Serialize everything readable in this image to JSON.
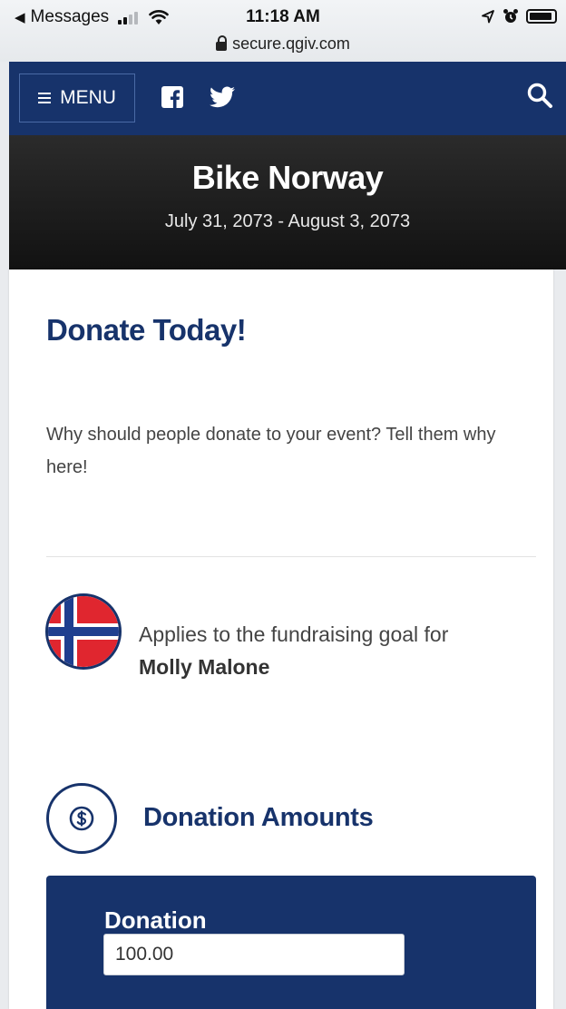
{
  "status_bar": {
    "back_app": "Messages",
    "time": "11:18 AM",
    "url": "secure.qgiv.com",
    "icons": [
      "signal-icon",
      "wifi-icon",
      "location-icon",
      "alarm-icon",
      "battery-icon"
    ]
  },
  "nav": {
    "menu_label": "MENU",
    "icons": [
      "hamburger-icon",
      "facebook-icon",
      "twitter-icon",
      "search-icon"
    ]
  },
  "hero": {
    "title": "Bike Norway",
    "dates": "July 31, 2073 - August 3, 2073"
  },
  "content": {
    "heading": "Donate Today!",
    "description": "Why should people donate to your event? Tell them why here!",
    "goal_prefix": "Applies to the fundraising goal for",
    "goal_name": "Molly Malone",
    "amounts_heading": "Donation Amounts",
    "donation_label": "Donation",
    "donation_value": "100.00"
  },
  "colors": {
    "brand_navy": "#17336b",
    "hero_dark": "#1c1c1c",
    "flag_red": "#e0262f",
    "flag_blue": "#1f3f8f"
  }
}
